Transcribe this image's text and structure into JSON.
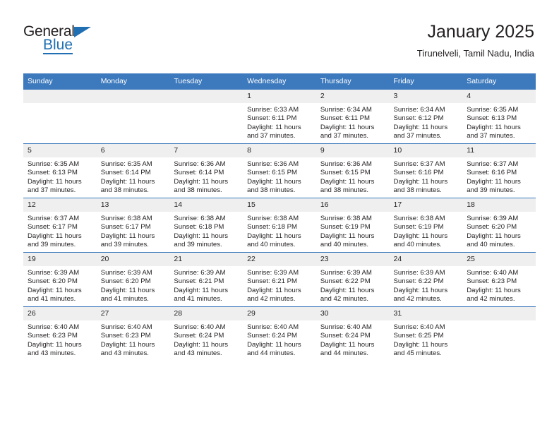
{
  "brand": {
    "name_top": "General",
    "name_bottom": "Blue",
    "accent_color": "#1f6fb2"
  },
  "header": {
    "title": "January 2025",
    "subtitle": "Tirunelveli, Tamil Nadu, India"
  },
  "theme": {
    "header_bg": "#3c79bd",
    "daynum_bg": "#efefef",
    "text_color": "#231f20",
    "grid_line": "#3c79bd"
  },
  "weekdays": [
    "Sunday",
    "Monday",
    "Tuesday",
    "Wednesday",
    "Thursday",
    "Friday",
    "Saturday"
  ],
  "weeks": [
    [
      {
        "day": "",
        "lines": []
      },
      {
        "day": "",
        "lines": []
      },
      {
        "day": "",
        "lines": []
      },
      {
        "day": "1",
        "lines": [
          "Sunrise: 6:33 AM",
          "Sunset: 6:11 PM",
          "Daylight: 11 hours",
          "and 37 minutes."
        ]
      },
      {
        "day": "2",
        "lines": [
          "Sunrise: 6:34 AM",
          "Sunset: 6:11 PM",
          "Daylight: 11 hours",
          "and 37 minutes."
        ]
      },
      {
        "day": "3",
        "lines": [
          "Sunrise: 6:34 AM",
          "Sunset: 6:12 PM",
          "Daylight: 11 hours",
          "and 37 minutes."
        ]
      },
      {
        "day": "4",
        "lines": [
          "Sunrise: 6:35 AM",
          "Sunset: 6:13 PM",
          "Daylight: 11 hours",
          "and 37 minutes."
        ]
      }
    ],
    [
      {
        "day": "5",
        "lines": [
          "Sunrise: 6:35 AM",
          "Sunset: 6:13 PM",
          "Daylight: 11 hours",
          "and 37 minutes."
        ]
      },
      {
        "day": "6",
        "lines": [
          "Sunrise: 6:35 AM",
          "Sunset: 6:14 PM",
          "Daylight: 11 hours",
          "and 38 minutes."
        ]
      },
      {
        "day": "7",
        "lines": [
          "Sunrise: 6:36 AM",
          "Sunset: 6:14 PM",
          "Daylight: 11 hours",
          "and 38 minutes."
        ]
      },
      {
        "day": "8",
        "lines": [
          "Sunrise: 6:36 AM",
          "Sunset: 6:15 PM",
          "Daylight: 11 hours",
          "and 38 minutes."
        ]
      },
      {
        "day": "9",
        "lines": [
          "Sunrise: 6:36 AM",
          "Sunset: 6:15 PM",
          "Daylight: 11 hours",
          "and 38 minutes."
        ]
      },
      {
        "day": "10",
        "lines": [
          "Sunrise: 6:37 AM",
          "Sunset: 6:16 PM",
          "Daylight: 11 hours",
          "and 38 minutes."
        ]
      },
      {
        "day": "11",
        "lines": [
          "Sunrise: 6:37 AM",
          "Sunset: 6:16 PM",
          "Daylight: 11 hours",
          "and 39 minutes."
        ]
      }
    ],
    [
      {
        "day": "12",
        "lines": [
          "Sunrise: 6:37 AM",
          "Sunset: 6:17 PM",
          "Daylight: 11 hours",
          "and 39 minutes."
        ]
      },
      {
        "day": "13",
        "lines": [
          "Sunrise: 6:38 AM",
          "Sunset: 6:17 PM",
          "Daylight: 11 hours",
          "and 39 minutes."
        ]
      },
      {
        "day": "14",
        "lines": [
          "Sunrise: 6:38 AM",
          "Sunset: 6:18 PM",
          "Daylight: 11 hours",
          "and 39 minutes."
        ]
      },
      {
        "day": "15",
        "lines": [
          "Sunrise: 6:38 AM",
          "Sunset: 6:18 PM",
          "Daylight: 11 hours",
          "and 40 minutes."
        ]
      },
      {
        "day": "16",
        "lines": [
          "Sunrise: 6:38 AM",
          "Sunset: 6:19 PM",
          "Daylight: 11 hours",
          "and 40 minutes."
        ]
      },
      {
        "day": "17",
        "lines": [
          "Sunrise: 6:38 AM",
          "Sunset: 6:19 PM",
          "Daylight: 11 hours",
          "and 40 minutes."
        ]
      },
      {
        "day": "18",
        "lines": [
          "Sunrise: 6:39 AM",
          "Sunset: 6:20 PM",
          "Daylight: 11 hours",
          "and 40 minutes."
        ]
      }
    ],
    [
      {
        "day": "19",
        "lines": [
          "Sunrise: 6:39 AM",
          "Sunset: 6:20 PM",
          "Daylight: 11 hours",
          "and 41 minutes."
        ]
      },
      {
        "day": "20",
        "lines": [
          "Sunrise: 6:39 AM",
          "Sunset: 6:20 PM",
          "Daylight: 11 hours",
          "and 41 minutes."
        ]
      },
      {
        "day": "21",
        "lines": [
          "Sunrise: 6:39 AM",
          "Sunset: 6:21 PM",
          "Daylight: 11 hours",
          "and 41 minutes."
        ]
      },
      {
        "day": "22",
        "lines": [
          "Sunrise: 6:39 AM",
          "Sunset: 6:21 PM",
          "Daylight: 11 hours",
          "and 42 minutes."
        ]
      },
      {
        "day": "23",
        "lines": [
          "Sunrise: 6:39 AM",
          "Sunset: 6:22 PM",
          "Daylight: 11 hours",
          "and 42 minutes."
        ]
      },
      {
        "day": "24",
        "lines": [
          "Sunrise: 6:39 AM",
          "Sunset: 6:22 PM",
          "Daylight: 11 hours",
          "and 42 minutes."
        ]
      },
      {
        "day": "25",
        "lines": [
          "Sunrise: 6:40 AM",
          "Sunset: 6:23 PM",
          "Daylight: 11 hours",
          "and 42 minutes."
        ]
      }
    ],
    [
      {
        "day": "26",
        "lines": [
          "Sunrise: 6:40 AM",
          "Sunset: 6:23 PM",
          "Daylight: 11 hours",
          "and 43 minutes."
        ]
      },
      {
        "day": "27",
        "lines": [
          "Sunrise: 6:40 AM",
          "Sunset: 6:23 PM",
          "Daylight: 11 hours",
          "and 43 minutes."
        ]
      },
      {
        "day": "28",
        "lines": [
          "Sunrise: 6:40 AM",
          "Sunset: 6:24 PM",
          "Daylight: 11 hours",
          "and 43 minutes."
        ]
      },
      {
        "day": "29",
        "lines": [
          "Sunrise: 6:40 AM",
          "Sunset: 6:24 PM",
          "Daylight: 11 hours",
          "and 44 minutes."
        ]
      },
      {
        "day": "30",
        "lines": [
          "Sunrise: 6:40 AM",
          "Sunset: 6:24 PM",
          "Daylight: 11 hours",
          "and 44 minutes."
        ]
      },
      {
        "day": "31",
        "lines": [
          "Sunrise: 6:40 AM",
          "Sunset: 6:25 PM",
          "Daylight: 11 hours",
          "and 45 minutes."
        ]
      },
      {
        "day": "",
        "lines": []
      }
    ]
  ]
}
